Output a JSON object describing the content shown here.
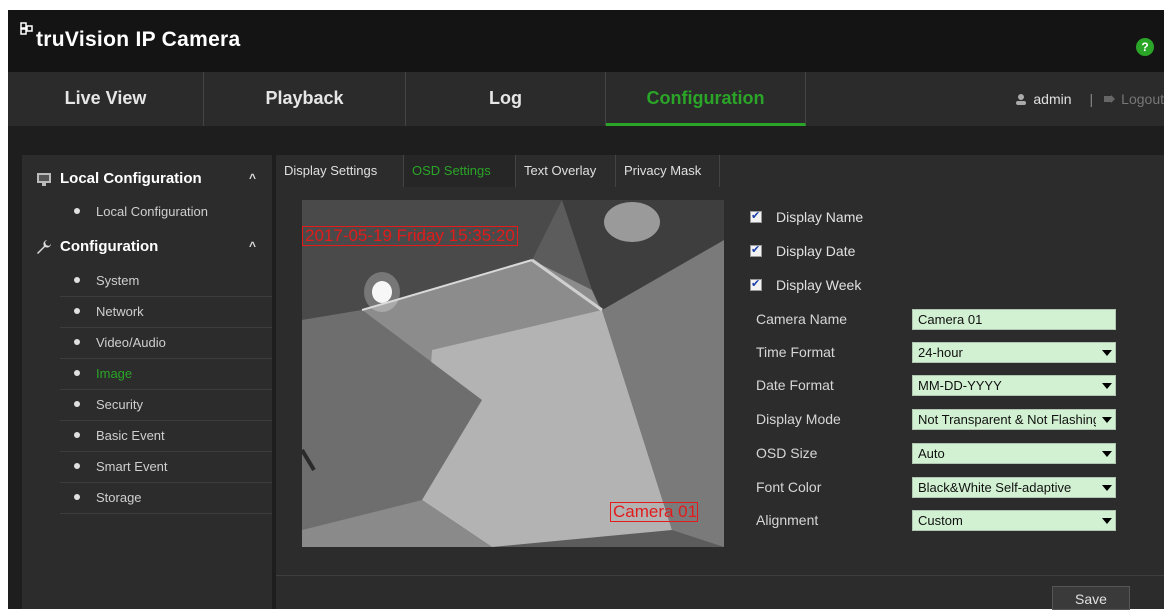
{
  "app": {
    "title": "truVision IP Camera",
    "help_label": "?"
  },
  "nav": {
    "tabs": [
      {
        "label": "Live View"
      },
      {
        "label": "Playback"
      },
      {
        "label": "Log"
      },
      {
        "label": "Configuration"
      }
    ],
    "user": "admin",
    "logout": "Logout"
  },
  "sidebar": {
    "local_header": "Local Configuration",
    "local_items": [
      {
        "label": "Local Configuration"
      }
    ],
    "config_header": "Configuration",
    "config_items": [
      {
        "label": "System"
      },
      {
        "label": "Network"
      },
      {
        "label": "Video/Audio"
      },
      {
        "label": "Image"
      },
      {
        "label": "Security"
      },
      {
        "label": "Basic Event"
      },
      {
        "label": "Smart Event"
      },
      {
        "label": "Storage"
      }
    ]
  },
  "subtabs": [
    {
      "label": "Display Settings"
    },
    {
      "label": "OSD Settings"
    },
    {
      "label": "Text Overlay"
    },
    {
      "label": "Privacy Mask"
    }
  ],
  "preview": {
    "date_overlay": "2017-05-19 Friday 15:35:20",
    "name_overlay": "Camera 01"
  },
  "checkboxes": [
    {
      "label": "Display Name",
      "checked": true
    },
    {
      "label": "Display Date",
      "checked": true
    },
    {
      "label": "Display Week",
      "checked": true
    }
  ],
  "form": {
    "camera_name_label": "Camera Name",
    "camera_name_value": "Camera 01",
    "time_format_label": "Time Format",
    "time_format_value": "24-hour",
    "date_format_label": "Date Format",
    "date_format_value": "MM-DD-YYYY",
    "display_mode_label": "Display Mode",
    "display_mode_value": "Not Transparent & Not Flashing",
    "osd_size_label": "OSD Size",
    "osd_size_value": "Auto",
    "font_color_label": "Font Color",
    "font_color_value": "Black&White Self-adaptive",
    "alignment_label": "Alignment",
    "alignment_value": "Custom"
  },
  "save_label": "Save",
  "colors": {
    "accent": "#2aa527",
    "overlay_red": "#e21b1b",
    "field_bg": "#d2f1d2"
  }
}
